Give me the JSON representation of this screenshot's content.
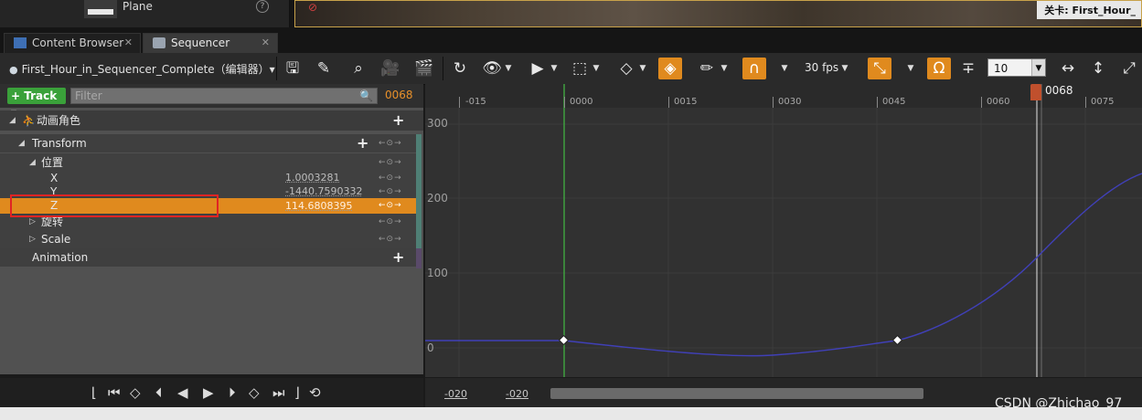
{
  "outliner": {
    "item_label": "Plane",
    "help_icon": "?"
  },
  "viewport": {
    "level_label": "关卡: First_Hour_"
  },
  "tabs": [
    {
      "label": "Content Browser",
      "close": "✕"
    },
    {
      "label": "Sequencer",
      "close": "✕"
    }
  ],
  "toolbar": {
    "sequence_name": "First_Hour_in_Sequencer_Complete（编辑器）▾",
    "fps": "30 fps",
    "snap_value": "10"
  },
  "track_bar": {
    "add_track_label": "+ Track ▾",
    "filter_placeholder": "Filter",
    "current_frame": "0068"
  },
  "tree": {
    "actor": "动画角色",
    "transform": "Transform",
    "location": "位置",
    "x": {
      "label": "X",
      "value": "1.0003281"
    },
    "y": {
      "label": "Y",
      "value": "-1440.7590332"
    },
    "z": {
      "label": "Z",
      "value": "114.6808395"
    },
    "rotation": "旋转",
    "scale": "Scale",
    "animation": "Animation",
    "key_nav": "←⊙→"
  },
  "ruler": {
    "ticks": [
      "-015",
      "0000",
      "0015",
      "0030",
      "0045",
      "0060",
      "0075"
    ],
    "playhead_label": "0068"
  },
  "y_axis": {
    "labels": [
      "300",
      "200",
      "100",
      "0"
    ]
  },
  "bottom": {
    "view_start": "-020",
    "view_end": "-020"
  },
  "watermark": "CSDN @Zhichao_97",
  "colors": {
    "accent_orange": "#e08a1e",
    "curve": "#4040b8",
    "selection_outline": "#e02424",
    "add_track_green": "#3aa13a"
  }
}
